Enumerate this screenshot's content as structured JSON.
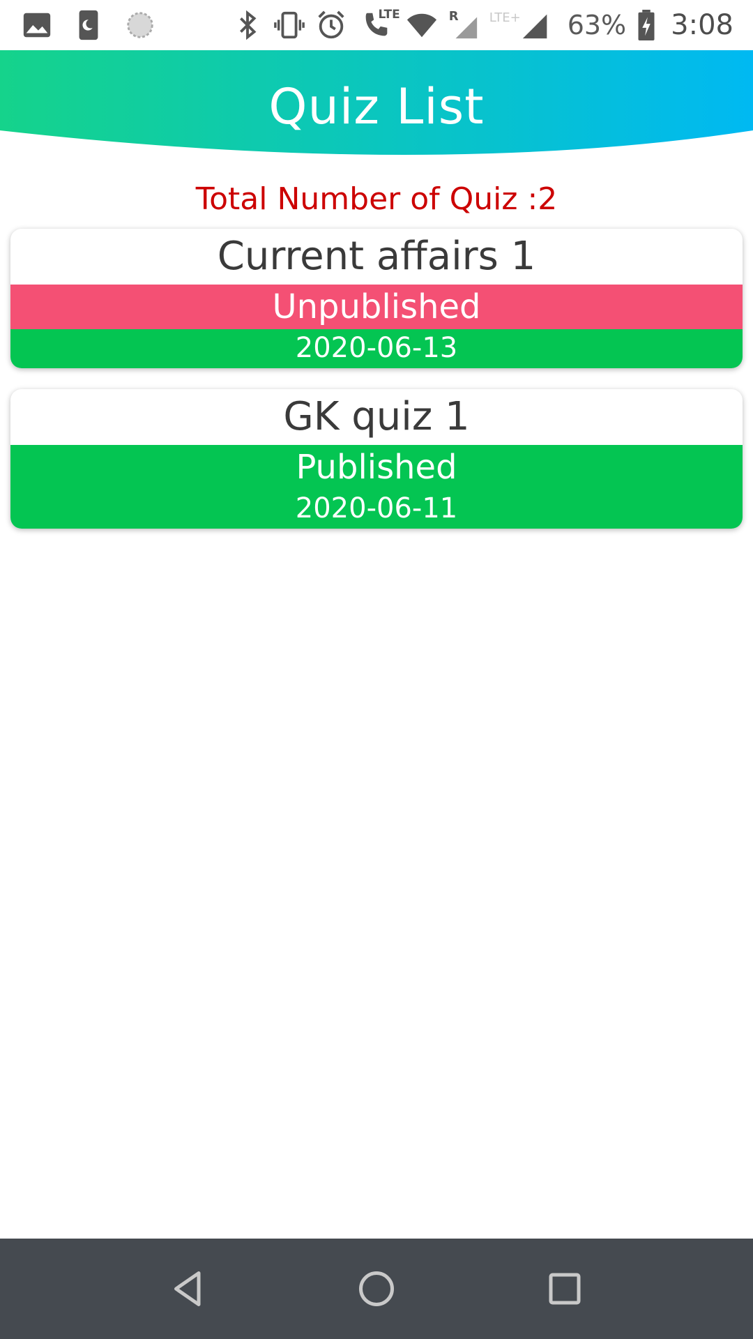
{
  "status_bar": {
    "battery_percent": "63%",
    "time": "3:08",
    "lte_label": "LTE",
    "lte_plus_label": "LTE+",
    "roaming_label": "R",
    "icons": [
      "gallery-icon",
      "do-not-disturb-icon",
      "loading-icon",
      "bluetooth-icon",
      "vibrate-icon",
      "alarm-icon",
      "volte-call-icon",
      "wifi-icon",
      "signal-roaming-icon",
      "signal-lte-plus-icon",
      "battery-charging-icon"
    ]
  },
  "header": {
    "title": "Quiz List",
    "gradient_start": "#15d38b",
    "gradient_end": "#00b9f2"
  },
  "summary": {
    "total_label": "Total Number of Quiz :2",
    "color": "#cc0000"
  },
  "quizzes": [
    {
      "title": "Current affairs 1",
      "status": "Unpublished",
      "date": "2020-06-13",
      "status_color": "#f45074"
    },
    {
      "title": "GK quiz 1",
      "status": "Published",
      "date": "2020-06-11",
      "status_color": "#04c552"
    }
  ],
  "nav_bar": {
    "buttons": [
      "back-icon",
      "home-icon",
      "recent-apps-icon"
    ],
    "background": "#454a50"
  }
}
